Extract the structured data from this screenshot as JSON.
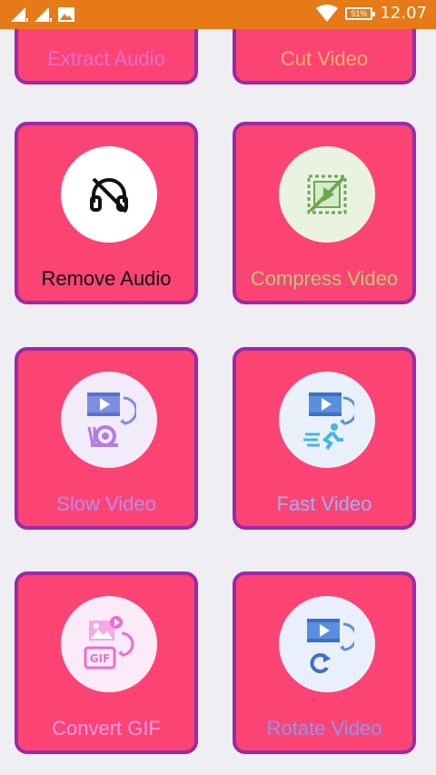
{
  "status_bar": {
    "time": "12.07",
    "battery": "91%"
  },
  "tools": [
    {
      "label": "Extract Audio",
      "label_color": "#e96fc9",
      "circle_color": "#ffffff",
      "icon": "extract-audio-icon"
    },
    {
      "label": "Cut Video",
      "label_color": "#f6b36b",
      "circle_color": "#ffffff",
      "icon": "cut-video-icon"
    },
    {
      "label": "Remove Audio",
      "label_color": "#111111",
      "circle_color": "#ffffff",
      "icon": "headphones-off-icon"
    },
    {
      "label": "Compress Video",
      "label_color": "#b8c879",
      "circle_color": "#eaf3e2",
      "icon": "compress-video-icon"
    },
    {
      "label": "Slow Video",
      "label_color": "#b78ee8",
      "circle_color": "#f2ebf9",
      "icon": "slow-video-snail-icon"
    },
    {
      "label": "Fast Video",
      "label_color": "#9cb0f5",
      "circle_color": "#e8f1fa",
      "icon": "fast-video-runner-icon"
    },
    {
      "label": "Convert GIF",
      "label_color": "#f59be6",
      "circle_color": "#fbeaf8",
      "icon": "convert-gif-icon"
    },
    {
      "label": "Rotate Video",
      "label_color": "#8f95f0",
      "circle_color": "#eaf0fb",
      "icon": "rotate-video-icon"
    }
  ]
}
